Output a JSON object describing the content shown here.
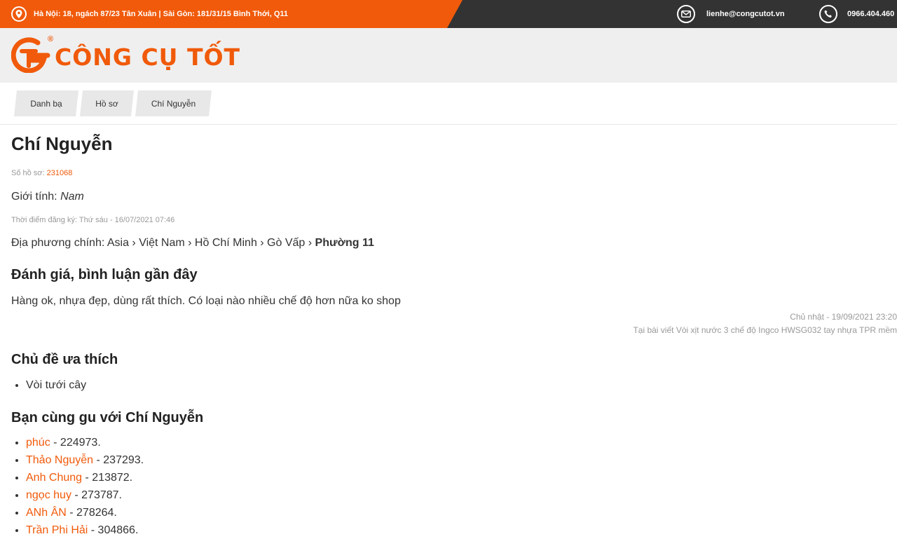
{
  "topbar": {
    "address": "Hà Nội: 18, ngách 87/23 Tân Xuân | Sài Gòn: 181/31/15 Bình Thới, Q11",
    "email": "lienhe@congcutot.vn",
    "phone": "0966.404.460",
    "colors": {
      "orange": "#f05a0a",
      "dark": "#333333"
    },
    "icons": [
      "location-pin-icon",
      "mail-icon",
      "phone-icon"
    ]
  },
  "logo": {
    "text": "CÔNG CỤ TỐT",
    "registered": "®"
  },
  "breadcrumb": [
    "Danh bạ",
    "Hồ sơ",
    "Chí Nguyễn"
  ],
  "profile": {
    "name": "Chí Nguyễn",
    "id_label": "Số hồ sơ:",
    "id_value": "231068",
    "gender_label": "Giới tính:",
    "gender_value": "Nam",
    "registered": "Thời điểm đăng ký: Thứ sáu - 16/07/2021 07:46",
    "location_label": "Địa phương chính:",
    "location_path": "Asia › Việt Nam › Hồ Chí Minh › Gò Vấp ›",
    "location_last": "Phường 11"
  },
  "reviews": {
    "heading": "Đánh giá, bình luận gần đây",
    "text": "Hàng ok, nhựa đẹp, dùng rất thích. Có loại nào nhiều chế độ hơn nữa ko shop",
    "date": "Chủ nhật - 19/09/2021 23:20",
    "source": "Tại bài viết Vòi xịt nước 3 chế độ Ingco HWSG032 tay nhựa TPR mềm"
  },
  "topics": {
    "heading": "Chủ đề ưa thích",
    "items": [
      "Vòi tưới cây"
    ]
  },
  "friends": {
    "heading": "Bạn cùng gu với Chí Nguyễn",
    "items": [
      {
        "name": "phúc",
        "id": " - 224973."
      },
      {
        "name": "Thảo Nguyễn",
        "id": " - 237293."
      },
      {
        "name": "Anh Chung",
        "id": " - 213872."
      },
      {
        "name": "ngọc huy",
        "id": " - 273787."
      },
      {
        "name": "ANh ÂN",
        "id": " - 278264."
      },
      {
        "name": "Trần Phi Hải",
        "id": " - 304866."
      }
    ]
  }
}
